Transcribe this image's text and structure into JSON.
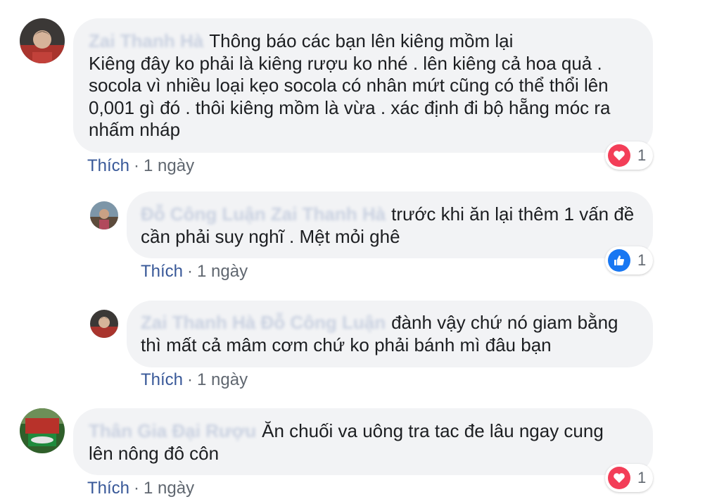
{
  "comments": [
    {
      "author": "Zai Thanh Hà",
      "text_first": "Thông báo các bạn lên kiêng mồm lại",
      "text_rest": "Kiêng đây ko phải là kiêng rượu ko nhé . lên kiêng cả hoa quả . socola vì nhiều loại kẹo socola có nhân mứt cũng có thể thổi lên 0,001 gì đó . thôi kiêng mồm là vừa . xác định đi bộ hẵng móc ra nhấm nháp",
      "like_label": "Thích",
      "separator": "·",
      "time": "1 ngày",
      "reaction": {
        "type": "love",
        "icon": "heart-icon",
        "count": "1"
      },
      "avatar_colors": [
        "#2d2a28",
        "#b2382f",
        "#d6b49a"
      ]
    },
    {
      "author": "Đỗ Công Luận Zai Thanh Hà",
      "text_first": "trước khi ăn lại thêm 1 vấn đề",
      "text_rest": "cần phải suy nghĩ . Mệt mỏi ghê",
      "like_label": "Thích",
      "separator": "·",
      "time": "1 ngày",
      "reaction": {
        "type": "like",
        "icon": "thumbs-up-icon",
        "count": "1"
      },
      "avatar_colors": [
        "#6f8aa0",
        "#5a4a3a",
        "#b44a5a"
      ]
    },
    {
      "author": "Zai Thanh Hà Đỗ Công Luận",
      "text_first": "đành vậy chứ nó giam bằng",
      "text_rest": "thì mất cả mâm cơm chứ ko phải bánh mì đâu bạn",
      "like_label": "Thích",
      "separator": "·",
      "time": "1 ngày",
      "reaction": null,
      "avatar_colors": [
        "#2d2a28",
        "#b2382f",
        "#d6b49a"
      ]
    },
    {
      "author": "Thân Gia Đại Rượu",
      "text_first": "Ăn chuối va uông tra tac đe lâu ngay cung",
      "text_rest": "lên nông đô côn",
      "like_label": "Thích",
      "separator": "·",
      "time": "1 ngày",
      "reaction": {
        "type": "love",
        "icon": "heart-icon",
        "count": "1"
      },
      "avatar_colors": [
        "#1f7a3a",
        "#c8362c",
        "#e0c060"
      ]
    }
  ],
  "colors": {
    "bubble_bg": "#f2f3f5",
    "link": "#385898",
    "meta": "#606770",
    "love": "#f33e58",
    "like": "#1877f2"
  }
}
